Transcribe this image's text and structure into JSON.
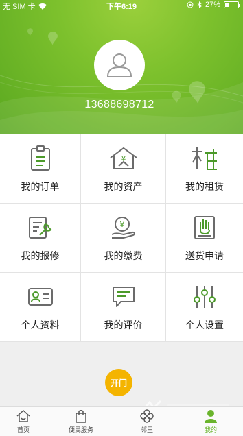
{
  "status": {
    "carrier": "无 SIM 卡",
    "time": "下午6:19",
    "battery_percent": "27%",
    "battery_level": 0.27,
    "icons": [
      "wifi-icon",
      "orientation-lock-icon",
      "bluetooth-icon",
      "battery-icon"
    ]
  },
  "profile": {
    "phone": "13688698712",
    "avatar_icon": "user-avatar-icon"
  },
  "menu": {
    "items": [
      {
        "label": "我的订单",
        "icon": "clipboard-icon"
      },
      {
        "label": "我的资产",
        "icon": "house-yuan-icon"
      },
      {
        "label": "我的租赁",
        "icon": "rent-icon"
      },
      {
        "label": "我的报修",
        "icon": "repair-form-icon"
      },
      {
        "label": "我的缴费",
        "icon": "payment-icon"
      },
      {
        "label": "送货申请",
        "icon": "hand-form-icon"
      },
      {
        "label": "个人资料",
        "icon": "id-card-icon"
      },
      {
        "label": "我的评价",
        "icon": "comment-icon"
      },
      {
        "label": "个人设置",
        "icon": "sliders-icon"
      }
    ]
  },
  "action": {
    "open_door_label": "开门"
  },
  "tabs": [
    {
      "label": "首页",
      "icon": "home-icon",
      "active": false
    },
    {
      "label": "便民服务",
      "icon": "bag-icon",
      "active": false
    },
    {
      "label": "邻里",
      "icon": "clover-icon",
      "active": false
    },
    {
      "label": "我的",
      "icon": "person-icon",
      "active": true
    }
  ],
  "colors": {
    "brand_green": "#6ab42c",
    "icon_green": "#4c9a2a",
    "icon_gray": "#6b6b6b",
    "open_button": "#f4b400"
  }
}
